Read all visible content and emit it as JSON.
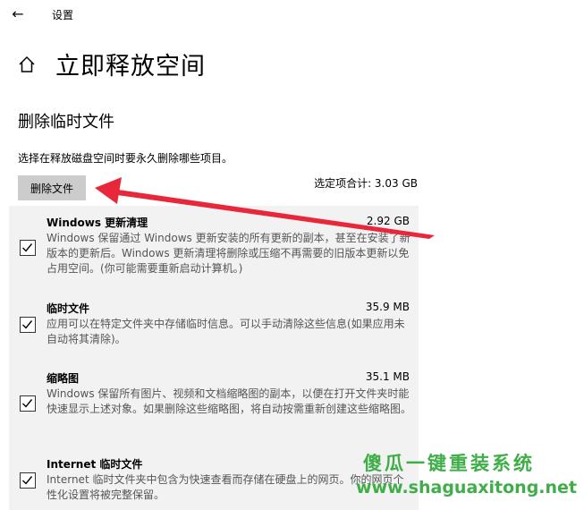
{
  "window": {
    "title": "设置"
  },
  "page": {
    "title": "立即释放空间"
  },
  "section": {
    "title": "删除临时文件",
    "description": "选择在释放磁盘空间时要永久删除哪些项目。",
    "delete_button": "删除文件",
    "selected_total": "选定项合计: 3.03 GB"
  },
  "items": [
    {
      "name": "Windows 更新清理",
      "size": "2.92 GB",
      "checked": true,
      "desc": "Windows 保留通过 Windows 更新安装的所有更新的副本，甚至在安装了新版本的更新后。Windows 更新清理将删除或压缩不再需要的旧版本更新以免占用空间。(你可能需要重新启动计算机。)"
    },
    {
      "name": "临时文件",
      "size": "35.9 MB",
      "checked": true,
      "desc": "应用可以在特定文件夹中存储临时信息。可以手动清除这些信息(如果应用未自动将其清除)。"
    },
    {
      "name": "缩略图",
      "size": "35.1 MB",
      "checked": true,
      "desc": "Windows 保留所有图片、视频和文档缩略图的副本，以便在打开文件夹时能快速显示上述对象。如果删除这些缩略图，将自动按需重新创建这些缩略图。"
    },
    {
      "name": "Internet 临时文件",
      "size": "",
      "checked": true,
      "desc": "Internet 临时文件夹中包含为快速查看而存储在硬盘上的网页。你的网页个性化设置将被完整保留。"
    }
  ],
  "watermark": {
    "title": "傻瓜一键重装系统",
    "url": "www.shaguaxitong.net"
  },
  "colors": {
    "accent": "#e8273a",
    "watermark": "#3fae49",
    "button": "#cccccc",
    "list_bg": "#f2f2f2"
  }
}
